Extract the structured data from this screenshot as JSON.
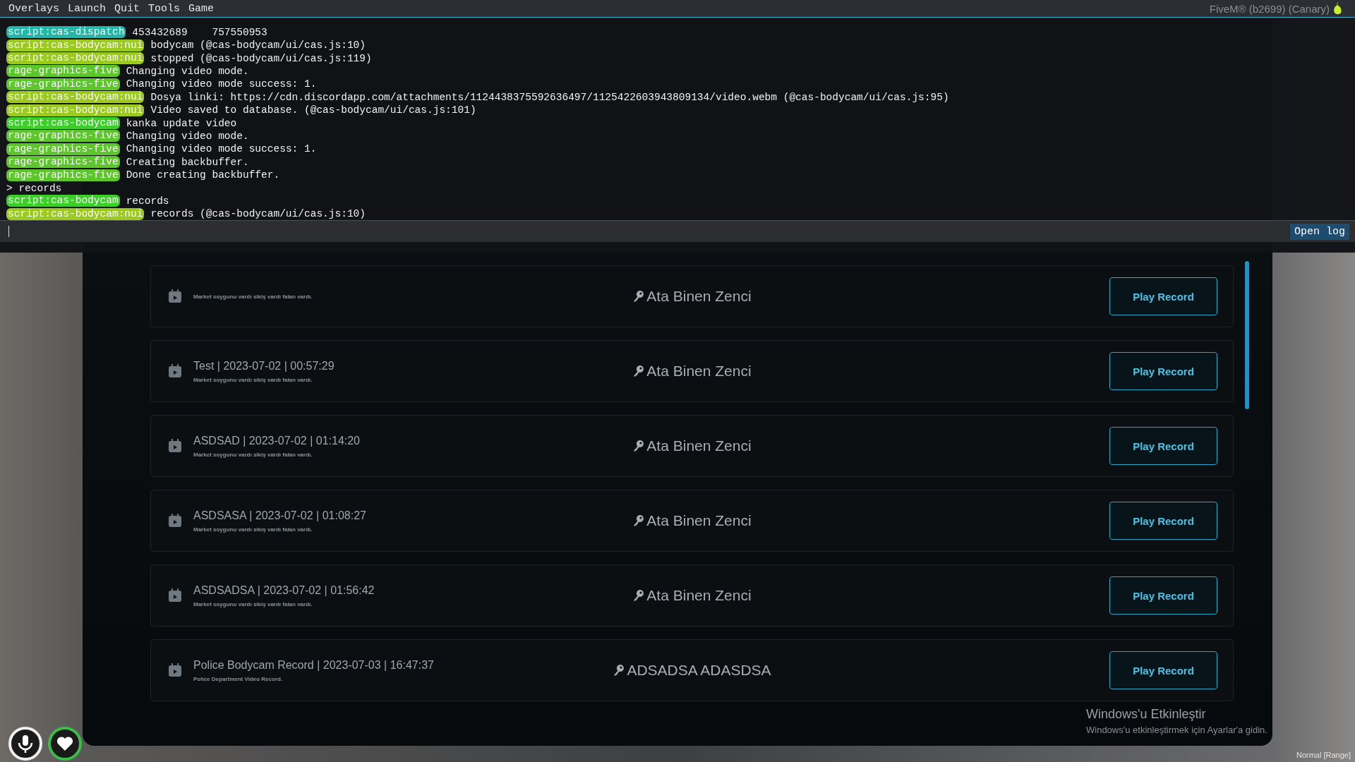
{
  "menu": [
    "Overlays",
    "Launch",
    "Quit",
    "Tools",
    "Game"
  ],
  "app_title": "FiveM® (b2699) (Canary)",
  "console": {
    "lines": [
      {
        "kind": "log",
        "tag": "script:cas-dispatch",
        "color": "#22b8a8",
        "text": "453432689    757550953"
      },
      {
        "kind": "log",
        "tag": "script:cas-bodycam:nui",
        "color": "#9acb1e",
        "text": "bodycam (@cas-bodycam/ui/cas.js:10)"
      },
      {
        "kind": "log",
        "tag": "script:cas-bodycam:nui",
        "color": "#9acb1e",
        "text": "stopped (@cas-bodycam/ui/cas.js:119)"
      },
      {
        "kind": "log",
        "tag": "rage-graphics-five",
        "color": "#5cc62c",
        "text": "Changing video mode."
      },
      {
        "kind": "log",
        "tag": "rage-graphics-five",
        "color": "#5cc62c",
        "text": "Changing video mode success: 1."
      },
      {
        "kind": "log",
        "tag": "script:cas-bodycam:nui",
        "color": "#9acb1e",
        "text": "Dosya linki: https://cdn.discordapp.com/attachments/1124438375592636497/1125422603943809134/video.webm (@cas-bodycam/ui/cas.js:95)"
      },
      {
        "kind": "log",
        "tag": "script:cas-bodycam:nui",
        "color": "#9acb1e",
        "text": "Video saved to database. (@cas-bodycam/ui/cas.js:101)"
      },
      {
        "kind": "log",
        "tag": "script:cas-bodycam",
        "color": "#3ccf2a",
        "text": "kanka update video"
      },
      {
        "kind": "log",
        "tag": "rage-graphics-five",
        "color": "#5cc62c",
        "text": "Changing video mode."
      },
      {
        "kind": "log",
        "tag": "rage-graphics-five",
        "color": "#5cc62c",
        "text": "Changing video mode success: 1."
      },
      {
        "kind": "log",
        "tag": "rage-graphics-five",
        "color": "#5cc62c",
        "text": "Creating backbuffer."
      },
      {
        "kind": "log",
        "tag": "rage-graphics-five",
        "color": "#5cc62c",
        "text": "Done creating backbuffer."
      },
      {
        "kind": "command",
        "text": "> records"
      },
      {
        "kind": "log",
        "tag": "script:cas-bodycam",
        "color": "#3ccf2a",
        "text": "records"
      },
      {
        "kind": "log",
        "tag": "script:cas-bodycam:nui",
        "color": "#9acb1e",
        "text": "records (@cas-bodycam/ui/cas.js:10)"
      }
    ],
    "button": "Open log"
  },
  "records": [
    {
      "description": "Market soygunu vardı sikiş vardı falan vardı.",
      "owner": "Ata Binen Zenci",
      "button": "Play Record"
    },
    {
      "title": "Test | 2023-07-02 | 00:57:29",
      "description": "Market soygunu vardı sikiş vardı falan vardı.",
      "owner": "Ata Binen Zenci",
      "button": "Play Record"
    },
    {
      "title": "ASDSAD | 2023-07-02 | 01:14:20",
      "description": "Market soygunu vardı sikiş vardı falan vardı.",
      "owner": "Ata Binen Zenci",
      "button": "Play Record"
    },
    {
      "title": "ASDSASA | 2023-07-02 | 01:08:27",
      "description": "Market soygunu vardı sikiş vardı falan vardı.",
      "owner": "Ata Binen Zenci",
      "button": "Play Record"
    },
    {
      "title": "ASDSADSA | 2023-07-02 | 01:56:42",
      "description": "Market soygunu vardı sikiş vardı falan vardı.",
      "owner": "Ata Binen Zenci",
      "button": "Play Record"
    },
    {
      "title": "Police Bodycam Record | 2023-07-03 | 16:47:37",
      "description": "Police Department Video Record.",
      "owner": "ADSADSA ADASDSA",
      "button": "Play Record"
    }
  ],
  "activation": {
    "title": "Windows'u Etkinleştir",
    "text": "Windows'u etkinleştirmek için Ayarlar'a gidin."
  },
  "voice_mode": "Normal [Range]"
}
